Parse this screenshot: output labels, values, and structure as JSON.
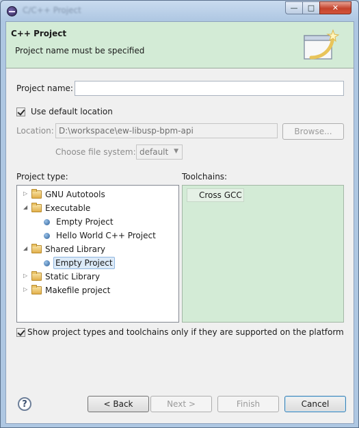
{
  "window": {
    "title": "C/C++ Project",
    "min_glyph": "—",
    "max_glyph": "□",
    "close_glyph": "✕"
  },
  "banner": {
    "title": "C++ Project",
    "message": "Project name must be specified"
  },
  "form": {
    "project_name_label": "Project name:",
    "project_name_value": "",
    "use_default_label": "Use default location",
    "use_default_checked": true,
    "location_label": "Location:",
    "location_value": "D:\\workspace\\ew-libusp-bpm-api",
    "browse_label": "Browse...",
    "file_system_label": "Choose file system:",
    "file_system_value": "default"
  },
  "project_type": {
    "label": "Project type:",
    "items": [
      {
        "label": "GNU Autotools",
        "kind": "folder",
        "expanded": false
      },
      {
        "label": "Executable",
        "kind": "folder",
        "expanded": true
      },
      {
        "label": "Empty Project",
        "kind": "leaf"
      },
      {
        "label": "Hello World C++ Project",
        "kind": "leaf"
      },
      {
        "label": "Shared Library",
        "kind": "folder",
        "expanded": true
      },
      {
        "label": "Empty Project",
        "kind": "leaf",
        "selected": true
      },
      {
        "label": "Static Library",
        "kind": "folder",
        "expanded": false
      },
      {
        "label": "Makefile project",
        "kind": "folder",
        "expanded": false
      }
    ]
  },
  "toolchains": {
    "label": "Toolchains:",
    "items": [
      "Cross GCC"
    ]
  },
  "filter_checkbox": {
    "label": "Show project types and toolchains only if they are supported on the platform",
    "checked": true
  },
  "buttons": {
    "back": "< Back",
    "next": "Next >",
    "finish": "Finish",
    "cancel": "Cancel",
    "help_glyph": "?"
  },
  "colors": {
    "banner_bg": "#d3ebd6",
    "toolchain_bg": "#d3ebd6",
    "selection": "#dceaf8"
  }
}
